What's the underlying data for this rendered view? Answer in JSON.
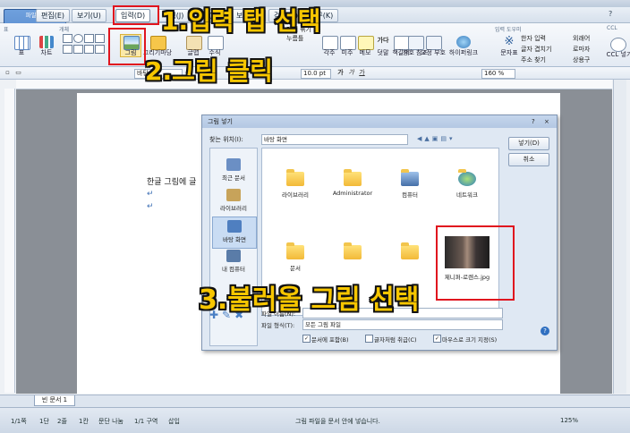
{
  "app": {
    "title": "빈 문서 1 - 한컴오피스 한글"
  },
  "menu": {
    "items": [
      "파일(F)",
      "편집(E)",
      "보기(U)",
      "입력(D)",
      "서식(J)",
      "쪽(W)",
      "보안(R)",
      "검토(H)",
      "도구(K)"
    ]
  },
  "ribbon": {
    "group_labels": [
      "표",
      "개체",
      "입력 도우미"
    ],
    "buttons": [
      "표",
      "차트",
      "그림",
      "그리기마당",
      "글맵",
      "수식",
      "각주",
      "미주",
      "메모",
      "덧말",
      "책갈피",
      "상호 참조",
      "교정 부호",
      "하이퍼링크",
      "문자표"
    ],
    "side_items": [
      "한자 입력",
      "글자 겹치기",
      "주소 찾기",
      "외래어",
      "로마자",
      "상용구",
      "개체 묶기",
      "누름틀"
    ],
    "ccl_label": "CCL",
    "ccl_button": "CCL 넣기"
  },
  "format": {
    "font": "바탕",
    "size": "10.0 pt",
    "zoom": "160 %",
    "bold": "가",
    "italic": "가",
    "underline": "가"
  },
  "document": {
    "line1": "한글 그림에 글",
    "para_mark": "↵"
  },
  "dialog": {
    "title": "그림 넣기",
    "location_label": "찾는 위치(I):",
    "location_value": "바탕 화면",
    "places": [
      "최근 문서",
      "라이브러리",
      "바탕 화면",
      "내 컴퓨터"
    ],
    "files": [
      "라이브러리",
      "Administrator",
      "컴퓨터",
      "네트워크",
      "문서",
      "",
      "",
      "제니퍼-로렌스.jpg"
    ],
    "open_button": "넣기(D)",
    "cancel_button": "취소",
    "filename_label": "파일 이름(N):",
    "filename_value": "",
    "filetype_label": "파일 형식(T):",
    "filetype_value": "모든 그림 파일",
    "checkboxes": [
      {
        "label": "문서에 포함(B)",
        "checked": true
      },
      {
        "label": "글자처럼 취급(C)",
        "checked": false
      },
      {
        "label": "마우스로 크기 지정(S)",
        "checked": true
      }
    ]
  },
  "annotations": {
    "step1": "1.입력 탭 선택",
    "step2": "2.그림 클릭",
    "step3": "3.불러올 그림 선택"
  },
  "statusbar": {
    "page": "1/1쪽",
    "section": "1단",
    "line": "2줄",
    "col": "1칸",
    "mode": "문단 나눔",
    "section2": "1/1 구역",
    "insert": "삽입",
    "message": "그림 파일을 문서 안에 넣습니다.",
    "zoom": "125%"
  },
  "tabs": {
    "doc": "빈 문서 1"
  }
}
